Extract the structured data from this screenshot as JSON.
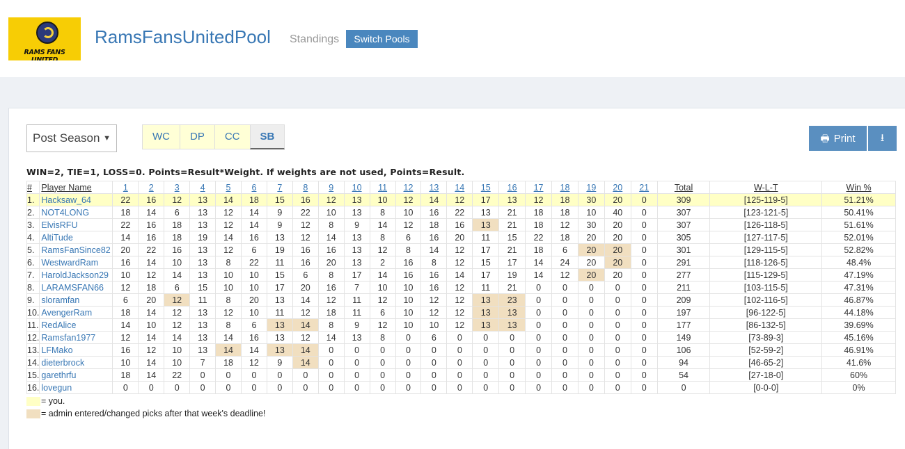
{
  "header": {
    "logo_text": "RAMS FANS UNITED",
    "title": "RamsFansUnitedPool",
    "subtitle": "Standings",
    "switch_label": "Switch Pools"
  },
  "controls": {
    "season_value": "Post Season",
    "tabs": [
      "WC",
      "DP",
      "CC",
      "SB"
    ],
    "active_tab": "SB",
    "print_label": "Print"
  },
  "rule_text": "WIN=2, TIE=1, LOSS=0. Points=Result*Weight. If weights are not used, Points=Result.",
  "table": {
    "rank_header": "#",
    "name_header": "Player Name",
    "weeks": [
      "1",
      "2",
      "3",
      "4",
      "5",
      "6",
      "7",
      "8",
      "9",
      "10",
      "11",
      "12",
      "13",
      "14",
      "15",
      "16",
      "17",
      "18",
      "19",
      "20",
      "21"
    ],
    "total_header": "Total",
    "wlt_header": "W-L-T",
    "winpct_header": "Win %",
    "rows": [
      {
        "rank": "1.",
        "name": "Hacksaw_64",
        "me": true,
        "scores": [
          22,
          16,
          12,
          13,
          14,
          18,
          15,
          16,
          12,
          13,
          10,
          12,
          14,
          12,
          17,
          13,
          12,
          18,
          30,
          20,
          0
        ],
        "admin": [
          5,
          9,
          16,
          20
        ],
        "total": "309",
        "wlt": "[125-119-5]",
        "pct": "51.21%"
      },
      {
        "rank": "2.",
        "name": "NOT4LONG",
        "scores": [
          18,
          14,
          6,
          13,
          12,
          14,
          9,
          22,
          10,
          13,
          8,
          10,
          16,
          22,
          13,
          21,
          18,
          18,
          10,
          40,
          0
        ],
        "admin": [],
        "total": "307",
        "wlt": "[123-121-5]",
        "pct": "50.41%"
      },
      {
        "rank": "3.",
        "name": "ElvisRFU",
        "scores": [
          22,
          16,
          18,
          13,
          12,
          14,
          9,
          12,
          8,
          9,
          14,
          12,
          18,
          16,
          13,
          21,
          18,
          12,
          30,
          20,
          0
        ],
        "admin": [
          15
        ],
        "total": "307",
        "wlt": "[126-118-5]",
        "pct": "51.61%"
      },
      {
        "rank": "4.",
        "name": "AltiTude",
        "scores": [
          14,
          16,
          18,
          19,
          14,
          16,
          13,
          12,
          14,
          13,
          8,
          6,
          16,
          20,
          11,
          15,
          22,
          18,
          20,
          20,
          0
        ],
        "admin": [],
        "total": "305",
        "wlt": "[127-117-5]",
        "pct": "52.01%"
      },
      {
        "rank": "5.",
        "name": "RamsFanSince82",
        "scores": [
          20,
          22,
          16,
          13,
          12,
          6,
          19,
          16,
          16,
          13,
          12,
          8,
          14,
          12,
          17,
          21,
          18,
          6,
          20,
          20,
          0
        ],
        "admin": [
          19,
          20
        ],
        "total": "301",
        "wlt": "[129-115-5]",
        "pct": "52.82%"
      },
      {
        "rank": "6.",
        "name": "WestwardRam",
        "scores": [
          16,
          14,
          10,
          13,
          8,
          22,
          11,
          16,
          20,
          13,
          2,
          16,
          8,
          12,
          15,
          17,
          14,
          24,
          20,
          20,
          0
        ],
        "admin": [
          20
        ],
        "total": "291",
        "wlt": "[118-126-5]",
        "pct": "48.4%"
      },
      {
        "rank": "7.",
        "name": "HaroldJackson29",
        "scores": [
          10,
          12,
          14,
          13,
          10,
          10,
          15,
          6,
          8,
          17,
          14,
          16,
          16,
          14,
          17,
          19,
          14,
          12,
          20,
          20,
          0
        ],
        "admin": [
          19
        ],
        "total": "277",
        "wlt": "[115-129-5]",
        "pct": "47.19%"
      },
      {
        "rank": "8.",
        "name": "LARAMSFAN66",
        "scores": [
          12,
          18,
          6,
          15,
          10,
          10,
          17,
          20,
          16,
          7,
          10,
          10,
          16,
          12,
          11,
          21,
          0,
          0,
          0,
          0,
          0
        ],
        "admin": [],
        "total": "211",
        "wlt": "[103-115-5]",
        "pct": "47.31%"
      },
      {
        "rank": "9.",
        "name": "sloramfan",
        "scores": [
          6,
          20,
          12,
          11,
          8,
          20,
          13,
          14,
          12,
          11,
          12,
          10,
          12,
          12,
          13,
          23,
          0,
          0,
          0,
          0,
          0
        ],
        "admin": [
          3,
          15,
          16
        ],
        "total": "209",
        "wlt": "[102-116-5]",
        "pct": "46.87%"
      },
      {
        "rank": "10.",
        "name": "AvengerRam",
        "scores": [
          18,
          14,
          12,
          13,
          12,
          10,
          11,
          12,
          18,
          11,
          6,
          10,
          12,
          12,
          13,
          13,
          0,
          0,
          0,
          0,
          0
        ],
        "admin": [
          15,
          16
        ],
        "total": "197",
        "wlt": "[96-122-5]",
        "pct": "44.18%"
      },
      {
        "rank": "11.",
        "name": "RedAlice",
        "scores": [
          14,
          10,
          12,
          13,
          8,
          6,
          13,
          14,
          8,
          9,
          12,
          10,
          10,
          12,
          13,
          13,
          0,
          0,
          0,
          0,
          0
        ],
        "admin": [
          7,
          8,
          15,
          16
        ],
        "total": "177",
        "wlt": "[86-132-5]",
        "pct": "39.69%"
      },
      {
        "rank": "12.",
        "name": "Ramsfan1977",
        "scores": [
          12,
          14,
          14,
          13,
          14,
          16,
          13,
          12,
          14,
          13,
          8,
          0,
          6,
          0,
          0,
          0,
          0,
          0,
          0,
          0,
          0
        ],
        "admin": [],
        "total": "149",
        "wlt": "[73-89-3]",
        "pct": "45.16%"
      },
      {
        "rank": "13.",
        "name": "LFMako",
        "scores": [
          16,
          12,
          10,
          13,
          14,
          14,
          13,
          14,
          0,
          0,
          0,
          0,
          0,
          0,
          0,
          0,
          0,
          0,
          0,
          0,
          0
        ],
        "admin": [
          5,
          7,
          8
        ],
        "total": "106",
        "wlt": "[52-59-2]",
        "pct": "46.91%"
      },
      {
        "rank": "14.",
        "name": "dieterbrock",
        "scores": [
          10,
          14,
          10,
          7,
          18,
          12,
          9,
          14,
          0,
          0,
          0,
          0,
          0,
          0,
          0,
          0,
          0,
          0,
          0,
          0,
          0
        ],
        "admin": [
          8
        ],
        "total": "94",
        "wlt": "[46-65-2]",
        "pct": "41.6%"
      },
      {
        "rank": "15.",
        "name": "garethrfu",
        "scores": [
          18,
          14,
          22,
          0,
          0,
          0,
          0,
          0,
          0,
          0,
          0,
          0,
          0,
          0,
          0,
          0,
          0,
          0,
          0,
          0,
          0
        ],
        "admin": [],
        "total": "54",
        "wlt": "[27-18-0]",
        "pct": "60%"
      },
      {
        "rank": "16.",
        "name": "lovegun",
        "scores": [
          0,
          0,
          0,
          0,
          0,
          0,
          0,
          0,
          0,
          0,
          0,
          0,
          0,
          0,
          0,
          0,
          0,
          0,
          0,
          0,
          0
        ],
        "admin": [],
        "total": "0",
        "wlt": "[0-0-0]",
        "pct": "0%"
      }
    ]
  },
  "legend": {
    "you_text": "= you.",
    "admin_text": "= admin entered/changed picks after that week's deadline!",
    "you_color": "#ffffc5",
    "admin_color": "#f1dfc0"
  }
}
